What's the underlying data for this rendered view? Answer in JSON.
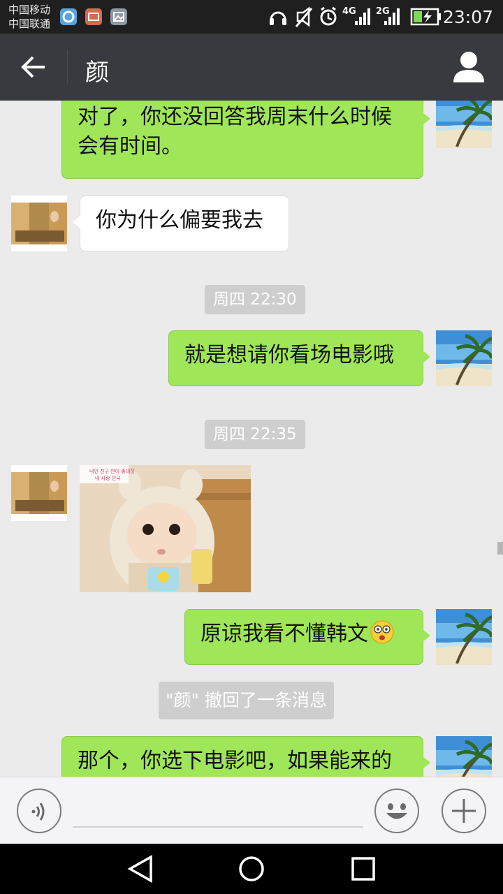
{
  "status_bar": {
    "carrier_1": "中国移动",
    "carrier_2": "中国联通",
    "network_4g": "4G",
    "network_2g": "2G",
    "time": "23:07"
  },
  "header": {
    "title": "颜"
  },
  "messages": [
    {
      "type": "sent",
      "text_line1": "对了，你还没回答我周末什么时候",
      "text_line2": "会有时间。"
    },
    {
      "type": "received",
      "text": "你为什么偏要我去"
    },
    {
      "type": "timestamp",
      "text": "周四 22:30"
    },
    {
      "type": "sent",
      "text": "就是想请你看场电影哦"
    },
    {
      "type": "timestamp",
      "text": "周四 22:35"
    },
    {
      "type": "received-image",
      "sticker_caption_1": "내인 친구 딴이 좋대잖",
      "sticker_caption_2": "내 사랑 민국"
    },
    {
      "type": "sent",
      "text": "原谅我看不懂韩文"
    },
    {
      "type": "system",
      "text": "\"颜\" 撤回了一条消息"
    },
    {
      "type": "sent",
      "text": "那个，你选下电影吧，如果能来的"
    }
  ],
  "input_bar": {
    "placeholder": ""
  },
  "colors": {
    "sent_bubble": "#9fe658",
    "received_bubble": "#ffffff",
    "titlebar": "#393a3f",
    "chat_bg": "#ebebeb"
  }
}
